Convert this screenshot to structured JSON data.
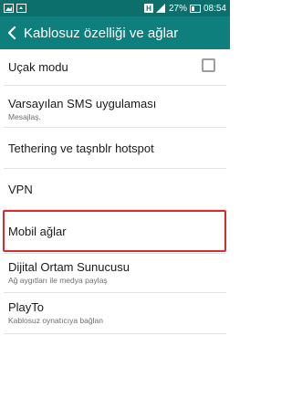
{
  "status_bar": {
    "battery_percent": "27%",
    "time": "08:54",
    "network_badge": "H",
    "icons": [
      "gallery-icon",
      "sync-icon",
      "network-h-icon",
      "signal-icon",
      "battery-icon"
    ]
  },
  "app_bar": {
    "title": "Kablosuz özelliği ve ağlar",
    "back_icon": "back-arrow-icon"
  },
  "settings": {
    "airplane_mode": {
      "title": "Uçak modu",
      "checked": false
    },
    "default_sms": {
      "title": "Varsayılan SMS uygulaması",
      "subtitle": "Mesajlaş."
    },
    "tethering": {
      "title": "Tethering ve taşnblr hotspot"
    },
    "vpn": {
      "title": "VPN"
    },
    "mobile_networks": {
      "title": "Mobil ağlar"
    },
    "dlna": {
      "title": "Dijital Ortam Sunucusu",
      "subtitle": "Ağ aygıtları ile medya paylaş"
    },
    "playto": {
      "title": "PlayTo",
      "subtitle": "Kablosuz oynatıcıya bağlan"
    }
  },
  "colors": {
    "status_bar": "#0c6f6c",
    "app_bar": "#0e7f7c",
    "highlight": "#d32f2f"
  }
}
